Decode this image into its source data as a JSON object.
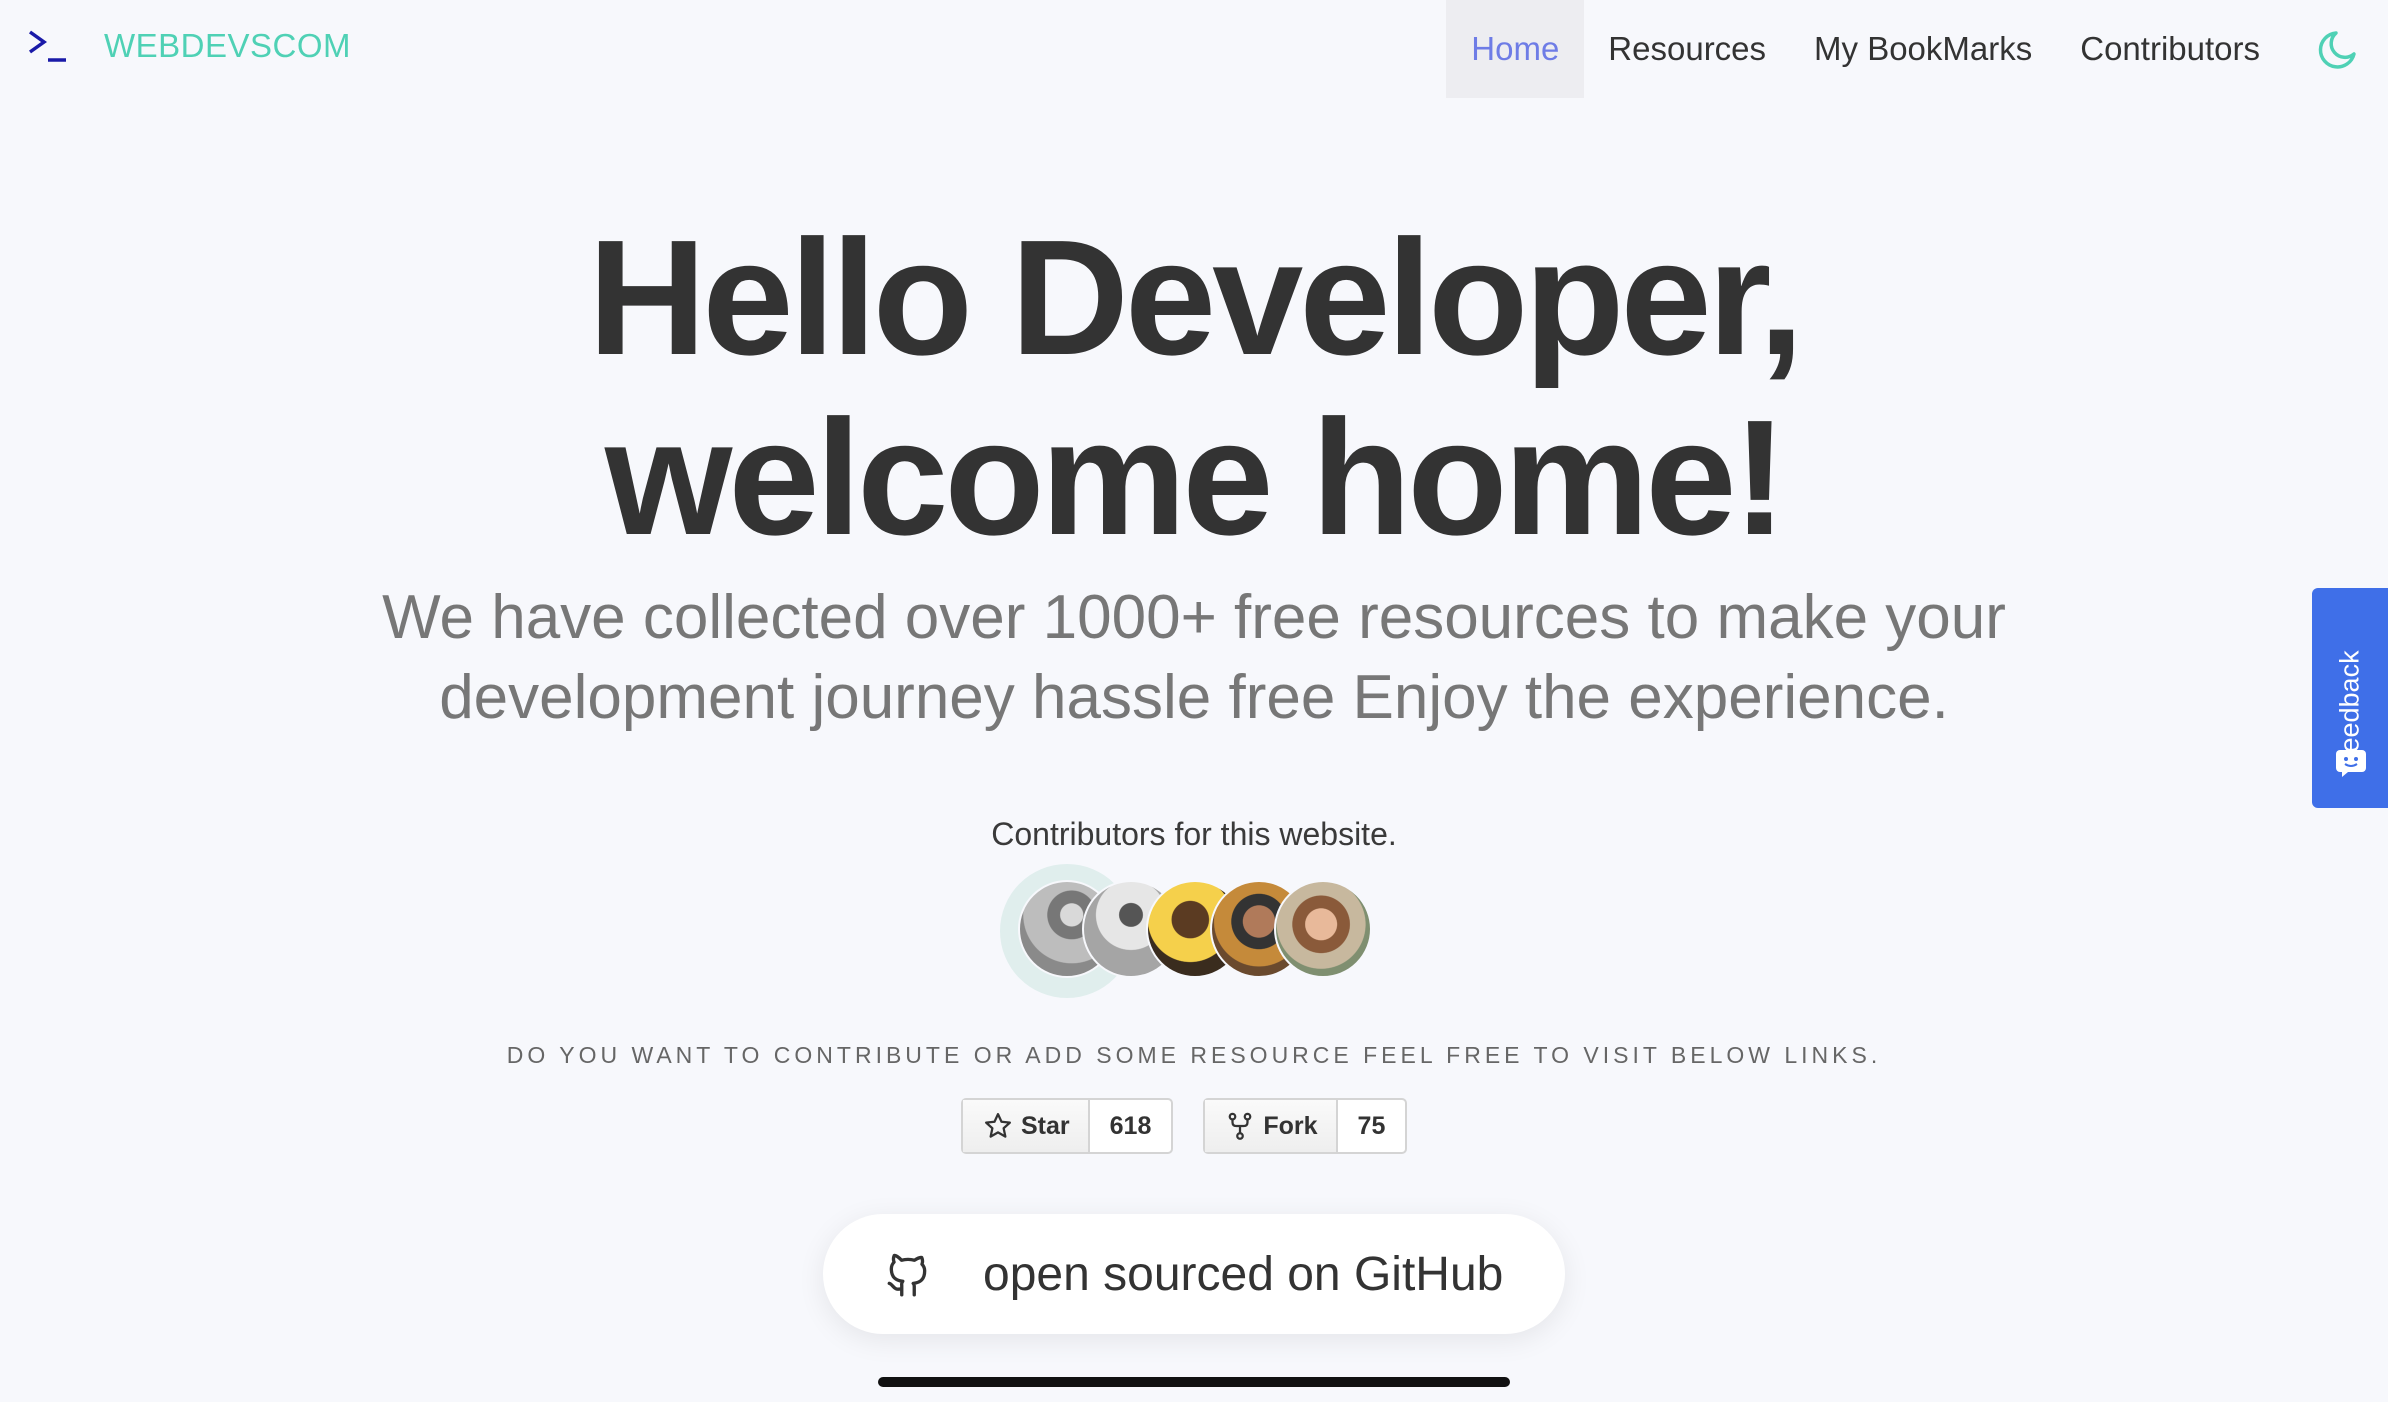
{
  "brand": {
    "name": "WEBDEVSCOM",
    "icon": "terminal-prompt-icon"
  },
  "nav": {
    "items": [
      {
        "label": "Home",
        "active": true
      },
      {
        "label": "Resources"
      },
      {
        "label": "My BookMarks"
      },
      {
        "label": "Contributors"
      }
    ],
    "theme_toggle_icon": "moon-icon"
  },
  "hero": {
    "title_line1": "Hello Developer,",
    "title_line2": "welcome home!",
    "subtitle": "We have collected over 1000+ free resources to make your development journey hassle free Enjoy the experience."
  },
  "contributors": {
    "title": "Contributors for this website.",
    "count": 5
  },
  "cta": {
    "text": "DO YOU WANT TO CONTRIBUTE OR ADD SOME RESOURCE FEEL FREE TO VISIT BELOW LINKS."
  },
  "github_buttons": {
    "star_label": "Star",
    "star_count": "618",
    "fork_label": "Fork",
    "fork_count": "75"
  },
  "github_link": {
    "label": "open sourced on GitHub",
    "icon": "github-icon"
  },
  "feedback": {
    "label": "Feedback",
    "icon": "chat-face-icon"
  },
  "colors": {
    "brand": "#4fd1b5",
    "active_nav": "#6e7ce6",
    "feedback_bg": "#3f6fe8",
    "background": "#f7f8fc"
  }
}
